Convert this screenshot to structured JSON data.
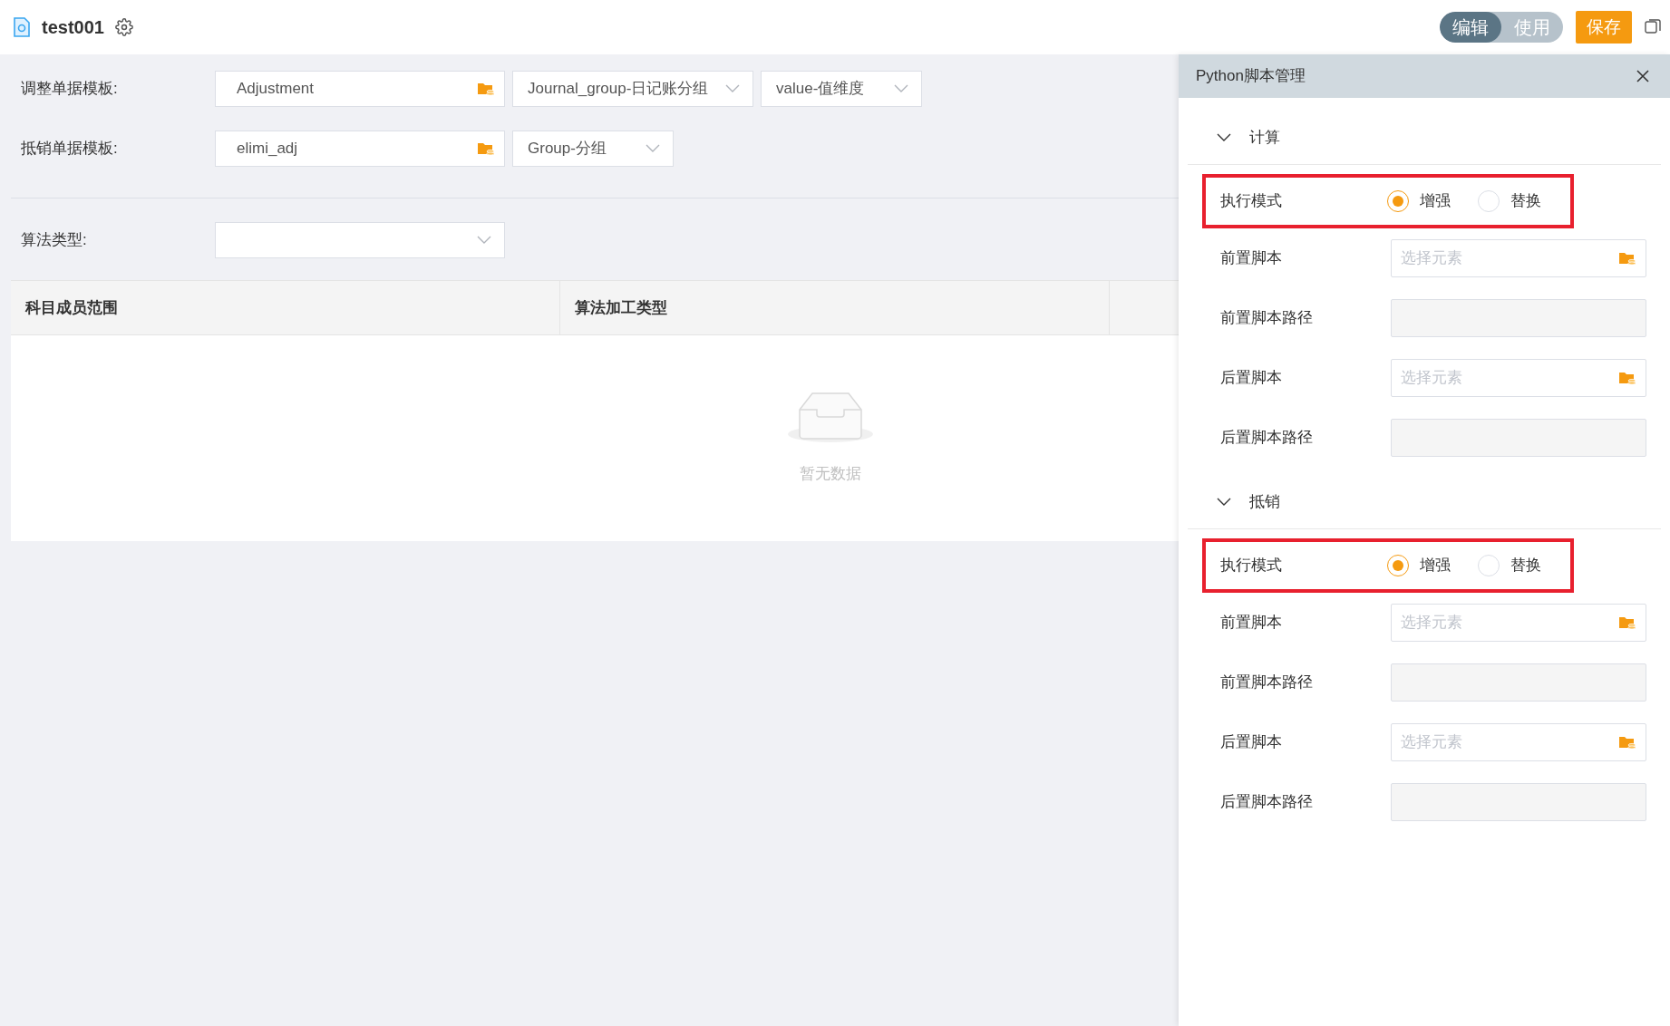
{
  "header": {
    "title": "test001",
    "mode_toggle": [
      {
        "label": "编辑",
        "selected": true
      },
      {
        "label": "使用",
        "selected": false
      }
    ],
    "save_button": "保存"
  },
  "form": {
    "rows": [
      {
        "label": "调整单据模板:",
        "fields": [
          {
            "kind": "picker",
            "value": "Adjustment"
          },
          {
            "kind": "select",
            "value": "Journal_group-日记账分组"
          },
          {
            "kind": "select",
            "value": "value-值维度"
          }
        ]
      },
      {
        "label": "抵销单据模板:",
        "fields": [
          {
            "kind": "picker",
            "value": "elimi_adj"
          },
          {
            "kind": "select",
            "value": "Group-分组"
          }
        ]
      }
    ],
    "algorithm": {
      "label": "算法类型:",
      "fields": [
        {
          "kind": "select"
        }
      ]
    }
  },
  "table": {
    "columns": [
      "科目成员范围",
      "算法加工类型"
    ],
    "empty_text": "暂无数据"
  },
  "panel": {
    "title": "Python脚本管理",
    "sections": [
      {
        "title": "计算",
        "expanded": true,
        "highlighted": true,
        "mode_label": "执行模式",
        "options": [
          {
            "label": "增强",
            "selected": true
          },
          {
            "label": "替换",
            "selected": false
          }
        ],
        "rows": [
          {
            "kind": "picker",
            "label": "前置脚本",
            "placeholder": "选择元素"
          },
          {
            "kind": "path",
            "label": "前置脚本路径"
          },
          {
            "kind": "picker",
            "label": "后置脚本",
            "placeholder": "选择元素"
          },
          {
            "kind": "path",
            "label": "后置脚本路径"
          }
        ]
      },
      {
        "title": "抵销",
        "expanded": true,
        "highlighted": true,
        "mode_label": "执行模式",
        "options": [
          {
            "label": "增强",
            "selected": true
          },
          {
            "label": "替换",
            "selected": false
          }
        ],
        "rows": [
          {
            "kind": "picker",
            "label": "前置脚本",
            "placeholder": "选择元素"
          },
          {
            "kind": "path",
            "label": "前置脚本路径"
          },
          {
            "kind": "picker",
            "label": "后置脚本",
            "placeholder": "选择元素"
          },
          {
            "kind": "path",
            "label": "后置脚本路径"
          }
        ]
      }
    ]
  }
}
